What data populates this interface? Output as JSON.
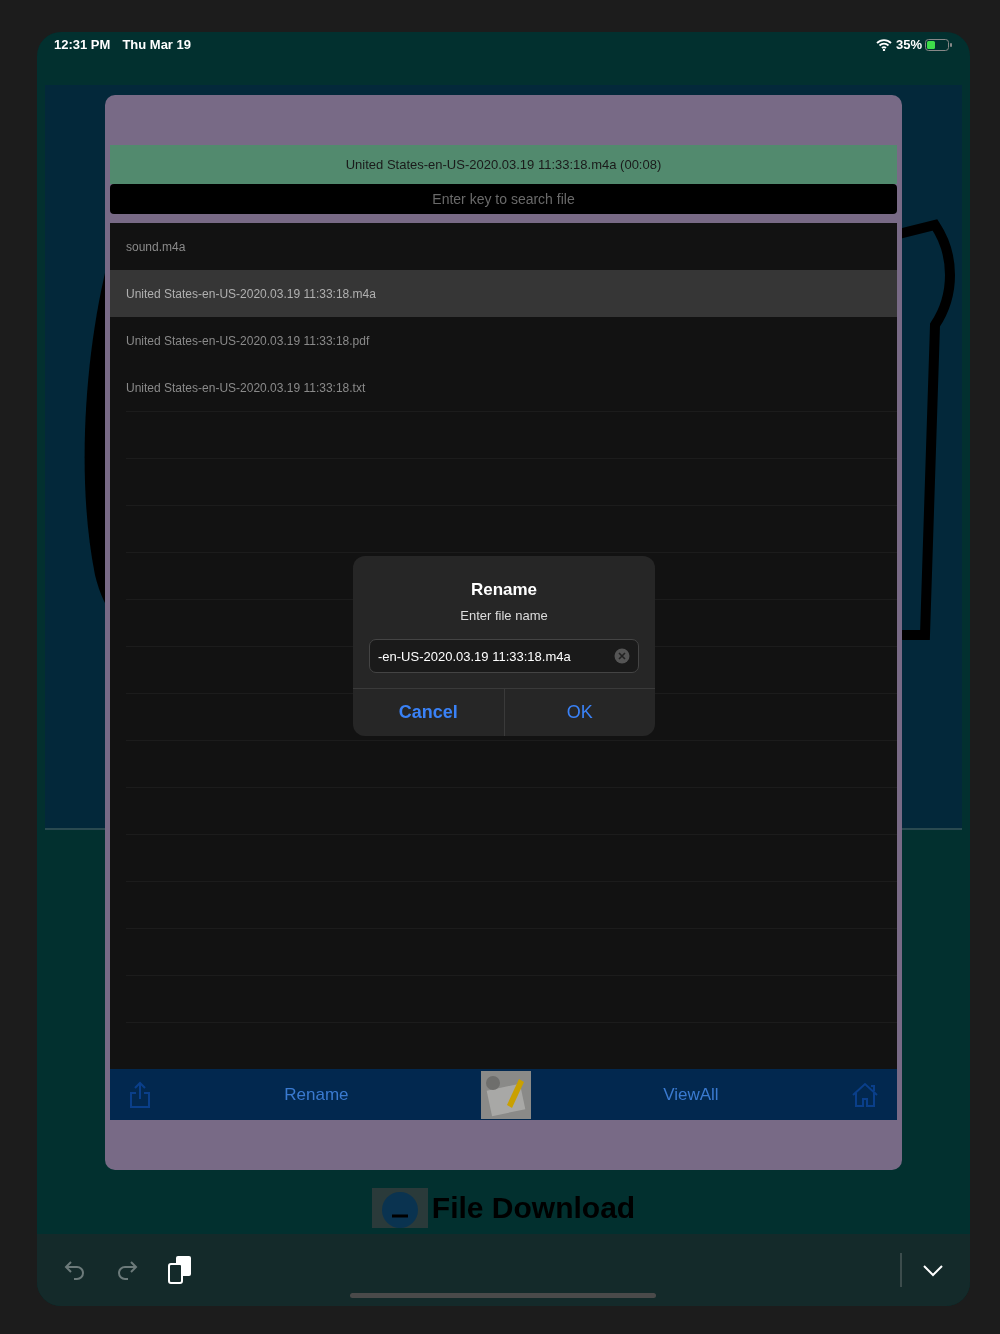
{
  "status_bar": {
    "time": "12:31 PM",
    "date": "Thu Mar 19",
    "battery": "35%"
  },
  "background": {
    "heading": "File Download"
  },
  "sheet": {
    "now_playing": "United States-en-US-2020.03.19 11:33:18.m4a (00:08)",
    "search": {
      "placeholder": "Enter key to search file"
    },
    "files": [
      {
        "name": "sound.m4a",
        "selected": false
      },
      {
        "name": "United States-en-US-2020.03.19 11:33:18.m4a",
        "selected": true
      },
      {
        "name": "United States-en-US-2020.03.19 11:33:18.pdf",
        "selected": false
      },
      {
        "name": "United States-en-US-2020.03.19 11:33:18.txt",
        "selected": false
      }
    ],
    "toolbar": {
      "rename": "Rename",
      "view_all": "ViewAll"
    }
  },
  "dialog": {
    "title": "Rename",
    "message": "Enter file name",
    "value": "-en-US-2020.03.19 11:33:18.m4a",
    "buttons": [
      {
        "label": "Cancel",
        "kind": "cancel"
      },
      {
        "label": "OK",
        "kind": "default"
      }
    ]
  }
}
